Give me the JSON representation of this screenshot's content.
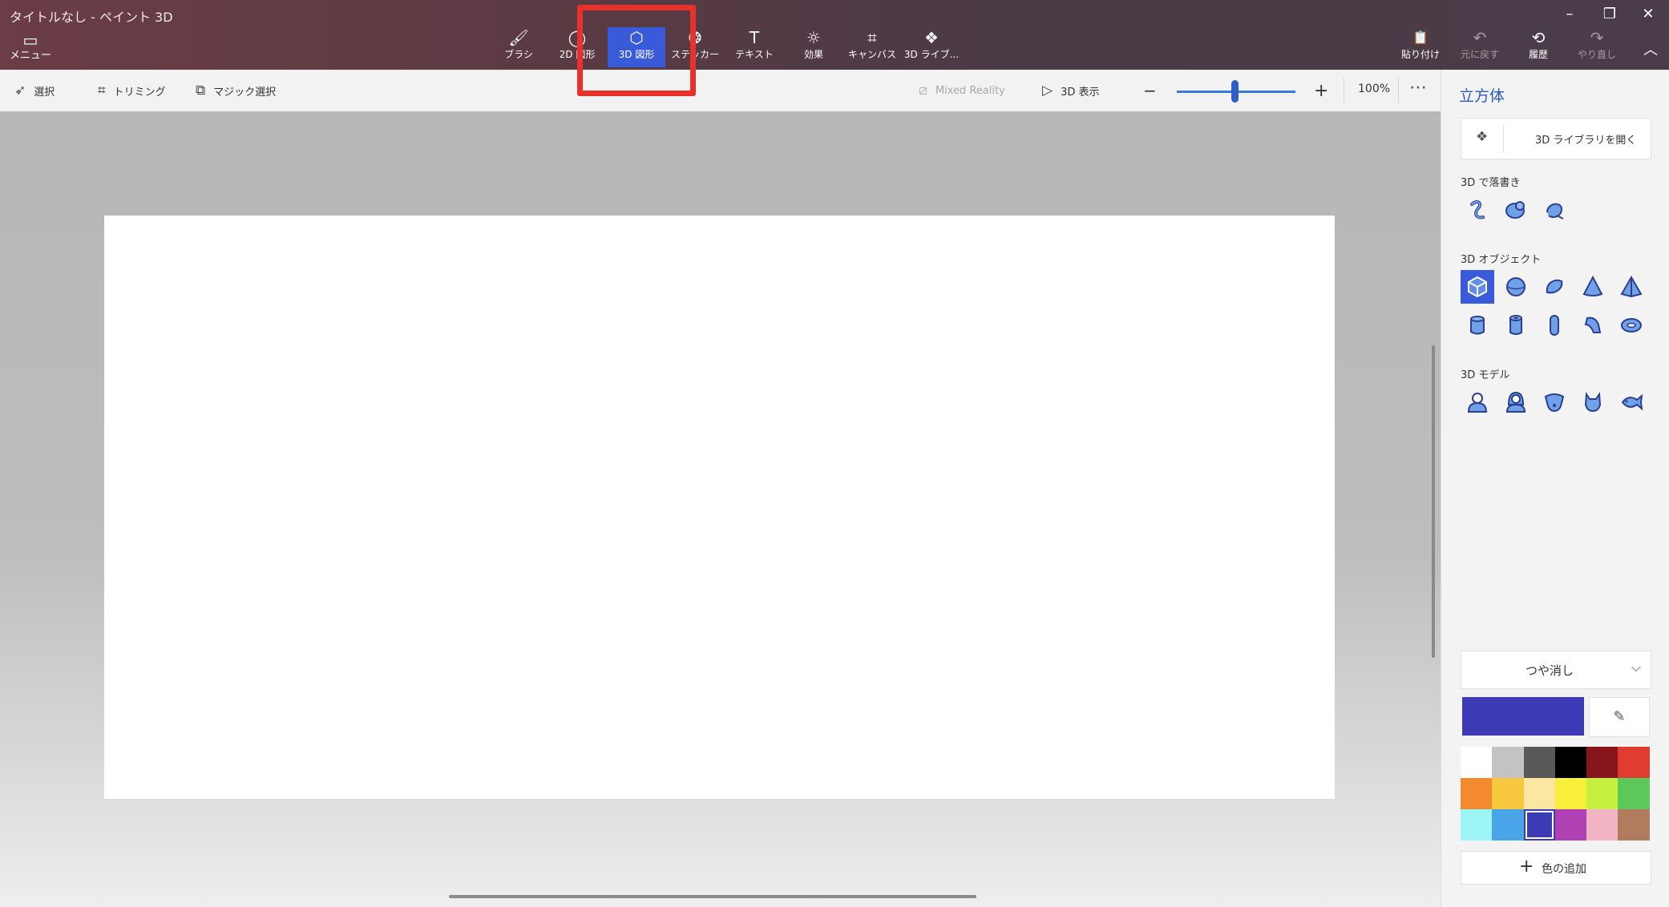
{
  "window": {
    "title": "タイトルなし - ペイント 3D",
    "minimize": "–",
    "restore": "❐",
    "close": "✕"
  },
  "menu": {
    "label": "メニュー"
  },
  "ribbon": {
    "tools": [
      {
        "label": "ブラシ",
        "icon": "brush-icon",
        "glyph": "🖌"
      },
      {
        "label": "2D 図形",
        "icon": "2d-shapes-icon",
        "glyph": "◯"
      },
      {
        "label": "3D 図形",
        "icon": "3d-shapes-icon",
        "glyph": "⬡"
      },
      {
        "label": "ステッカー",
        "icon": "sticker-icon",
        "glyph": "❂"
      },
      {
        "label": "テキスト",
        "icon": "text-icon",
        "glyph": "T"
      },
      {
        "label": "効果",
        "icon": "effects-icon",
        "glyph": "☼"
      },
      {
        "label": "キャンバス",
        "icon": "canvas-icon",
        "glyph": "⌗"
      },
      {
        "label": "3D ライブ...",
        "icon": "3d-library-icon",
        "glyph": "❖"
      }
    ],
    "right_tools": [
      {
        "label": "貼り付け",
        "glyph": "📋"
      },
      {
        "label": "元に戻す",
        "glyph": "↶"
      },
      {
        "label": "履歴",
        "glyph": "⟲"
      },
      {
        "label": "やり直し",
        "glyph": "↷"
      }
    ],
    "collapse_glyph": "︿",
    "active_color": "#3a5bd9"
  },
  "commandbar": {
    "select": "選択",
    "crop": "トリミング",
    "magic_select": "マジック選択",
    "mixed_reality": "Mixed Reality",
    "view_3d": "3D 表示",
    "zoom_out": "−",
    "zoom_in": "+",
    "zoom": "100%",
    "more": "⋯"
  },
  "panel": {
    "title": "立方体",
    "library_button": "3D ライブラリを開く",
    "doodle_label": "3D で落書き",
    "objects_label": "3D オブジェクト",
    "models_label": "3D モデル",
    "finish": "つや消し",
    "add_color": "色の追加",
    "current_color": "#3d3ab6",
    "swatches": [
      "#ffffff",
      "#c3c3c3",
      "#585858",
      "#000000",
      "#88141c",
      "#e03c31",
      "#f28b30",
      "#f9c73e",
      "#fbe7a1",
      "#f9ef3a",
      "#c6f03f",
      "#5dc85a",
      "#9ef5f7",
      "#4aa5e8",
      "#3d3ab6",
      "#b041b4",
      "#f3b5c6",
      "#b17b5e"
    ]
  }
}
